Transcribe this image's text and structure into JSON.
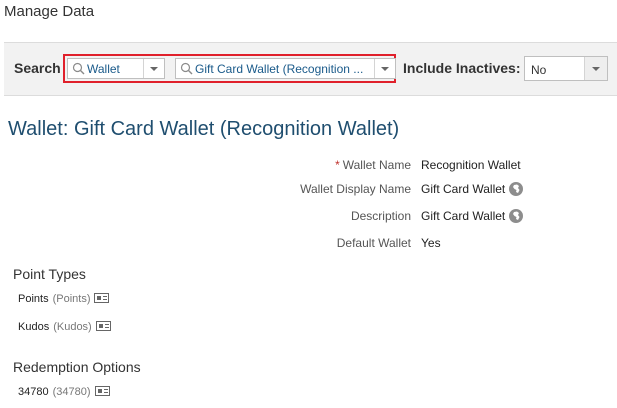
{
  "page": {
    "title": "Manage Data"
  },
  "search": {
    "label": "Search",
    "type_value": "Wallet",
    "item_value": "Gift Card Wallet (Recognition ...",
    "include_inactives_label": "Include Inactives:",
    "include_inactives_value": "No"
  },
  "wallet": {
    "title": "Wallet: Gift Card Wallet (Recognition Wallet)",
    "fields": [
      {
        "label": "Wallet Name",
        "required": "*",
        "value": "Recognition Wallet"
      },
      {
        "label": "Wallet Display Name",
        "value": "Gift Card Wallet",
        "icon": "globe-icon"
      },
      {
        "label": "Description",
        "value": "Gift Card Wallet",
        "icon": "globe-icon"
      },
      {
        "label": "Default Wallet",
        "value": "Yes"
      }
    ]
  },
  "point_types": {
    "title": "Point Types",
    "items": [
      {
        "name": "Points",
        "code": "(Points)"
      },
      {
        "name": "Kudos",
        "code": "(Kudos)"
      }
    ]
  },
  "redemption_options": {
    "title": "Redemption Options",
    "items": [
      {
        "name": "34780",
        "code": "(34780)"
      }
    ]
  }
}
